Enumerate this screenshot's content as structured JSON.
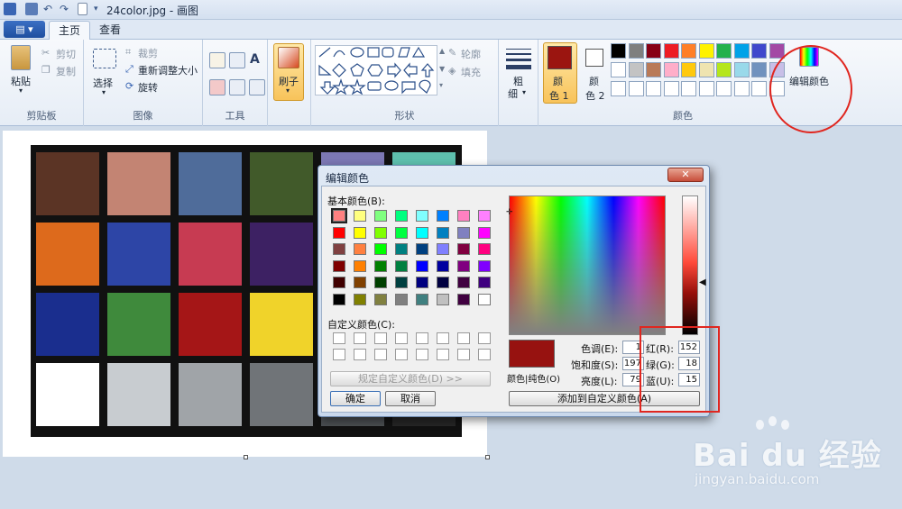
{
  "window": {
    "title": "24color.jpg - 画图"
  },
  "tabs": {
    "menu_label": "▤ ▾",
    "home": "主页",
    "view": "查看"
  },
  "ribbon": {
    "clipboard": {
      "paste": "粘贴",
      "cut": "剪切",
      "copy": "复制",
      "label": "剪贴板"
    },
    "image": {
      "select": "选择",
      "crop": "裁剪",
      "resize": "重新调整大小",
      "rotate": "旋转",
      "label": "图像"
    },
    "tools": {
      "label": "工具",
      "text_tool": "A"
    },
    "brush": {
      "label": "刷子"
    },
    "shapes": {
      "outline": "轮廓",
      "fill": "填充",
      "label": "形状"
    },
    "size": {
      "label_top": "粗",
      "label_bottom": "细"
    },
    "colors": {
      "color1_top": "颜",
      "color1_bottom": "色 1",
      "color2_top": "颜",
      "color2_bottom": "色 2",
      "edit_colors": "编辑颜色",
      "label": "颜色",
      "color1_value": "#9b1510",
      "color2_value": "#ffffff",
      "palette_row1": [
        "#000000",
        "#7f7f7f",
        "#880015",
        "#ed1c24",
        "#ff7f27",
        "#fff200",
        "#22b14c",
        "#00a2e8",
        "#3f48cc",
        "#a349a4"
      ],
      "palette_row2": [
        "#ffffff",
        "#c3c3c3",
        "#b97a57",
        "#ffaec9",
        "#ffc90e",
        "#efe4b0",
        "#b5e61d",
        "#99d9ea",
        "#7092be",
        "#c8bfe7"
      ]
    }
  },
  "canvas": {
    "patches": [
      "#5b3425",
      "#c38473",
      "#4f6c9a",
      "#415a2a",
      "#7c78b4",
      "#5ec0ae",
      "#dd6a1c",
      "#2d45a6",
      "#c73b52",
      "#3d2163",
      "#a3c33a",
      "#e69a25",
      "#1a2e8e",
      "#3f8a3c",
      "#a51617",
      "#f0d32a",
      "#b33d8e",
      "#1a8cb0",
      "#ffffff",
      "#c8ccd0",
      "#a0a4a8",
      "#707478",
      "#4a4e52",
      "#262626"
    ]
  },
  "dialog": {
    "title": "编辑颜色",
    "close": "✕",
    "basic_colors_label": "基本颜色(B):",
    "basic_colors": [
      "#ff8080",
      "#ffff80",
      "#80ff80",
      "#00ff80",
      "#80ffff",
      "#0080ff",
      "#ff80c0",
      "#ff80ff",
      "#ff0000",
      "#ffff00",
      "#80ff00",
      "#00ff40",
      "#00ffff",
      "#0080c0",
      "#8080c0",
      "#ff00ff",
      "#804040",
      "#ff8040",
      "#00ff00",
      "#008080",
      "#004080",
      "#8080ff",
      "#800040",
      "#ff0080",
      "#800000",
      "#ff8000",
      "#008000",
      "#008040",
      "#0000ff",
      "#0000a0",
      "#800080",
      "#8000ff",
      "#400000",
      "#804000",
      "#004000",
      "#004040",
      "#000080",
      "#000040",
      "#400040",
      "#400080",
      "#000000",
      "#808000",
      "#808040",
      "#808080",
      "#408080",
      "#c0c0c0",
      "#400040",
      "#ffffff"
    ],
    "custom_colors_label": "自定义颜色(C):",
    "define_custom_button": "规定自定义颜色(D) >>",
    "ok_button": "确定",
    "cancel_button": "取消",
    "preview_label": "颜色|纯色(O)",
    "preview_color": "#971210",
    "hue_label": "色调(E):",
    "hue_value": "1",
    "sat_label": "饱和度(S):",
    "sat_value": "197",
    "lum_label": "亮度(L):",
    "lum_value": "79",
    "red_label": "红(R):",
    "red_value": "152",
    "green_label": "绿(G):",
    "green_value": "18",
    "blue_label": "蓝(U):",
    "blue_value": "15",
    "add_custom_button": "添加到自定义颜色(A)"
  },
  "watermark": {
    "logo_text": "Bai du 经验",
    "url": "jingyan.baidu.com"
  },
  "annotation": {
    "color": "#e0261f"
  }
}
